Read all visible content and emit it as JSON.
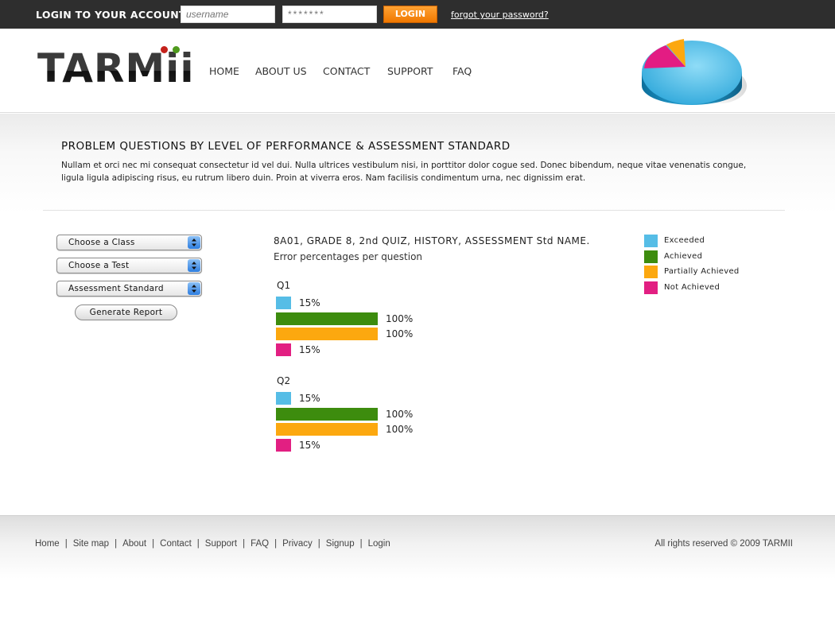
{
  "login": {
    "title": "LOGIN TO YOUR ACCOUNT",
    "username_placeholder": "username",
    "password_mask": "*******",
    "login_label": "LOGIN",
    "forgot_label": "forgot your password?"
  },
  "brand": {
    "logo_text": "TARMii"
  },
  "nav": {
    "items": [
      {
        "label": "HOME"
      },
      {
        "label": "ABOUT US"
      },
      {
        "label": "CONTACT"
      },
      {
        "label": "SUPPORT"
      },
      {
        "label": "FAQ"
      }
    ]
  },
  "intro": {
    "title": "PROBLEM QUESTIONS BY LEVEL OF PERFORMANCE & ASSESSMENT STANDARD",
    "text": "Nullam et orci nec mi consequat consectetur id vel dui. Nulla ultrices vestibulum nisi, in porttitor dolor cogue sed. Donec bibendum, neque vitae venenatis congue, ligula ligula adipiscing risus, eu rutrum libero duin. Proin at viverra eros. Nam facilisis condimentum urna, nec dignissim erat."
  },
  "controls": {
    "class_select": "Choose a Class",
    "test_select": "Choose a Test",
    "standard_select": "Assessment Standard",
    "generate_label": "Generate Report"
  },
  "report": {
    "title": "8A01, GRADE 8, 2nd QUIZ, HISTORY, ASSESSMENT Std NAME.",
    "subtitle": "Error percentages per question"
  },
  "legend": {
    "items": [
      {
        "label": "Exceeded",
        "color": "#56bde6"
      },
      {
        "label": "Achieved",
        "color": "#3d8c0e"
      },
      {
        "label": "Partially Achieved",
        "color": "#fca80f"
      },
      {
        "label": "Not Achieved",
        "color": "#e21f82"
      }
    ]
  },
  "chart_data": {
    "type": "bar",
    "orientation": "horizontal",
    "title": "Error percentages per question",
    "categories": [
      "Q1",
      "Q2"
    ],
    "value_suffix": "%",
    "series": [
      {
        "name": "Exceeded",
        "color": "#56bde6",
        "values": [
          15,
          15
        ]
      },
      {
        "name": "Achieved",
        "color": "#3d8c0e",
        "values": [
          100,
          100
        ]
      },
      {
        "name": "Partially Achieved",
        "color": "#fca80f",
        "values": [
          100,
          100
        ]
      },
      {
        "name": "Not Achieved",
        "color": "#e21f82",
        "values": [
          15,
          15
        ]
      }
    ],
    "xlim": [
      0,
      100
    ],
    "legend_placement": "right"
  },
  "footer": {
    "links": [
      {
        "label": "Home"
      },
      {
        "label": "Site map"
      },
      {
        "label": "About"
      },
      {
        "label": "Contact"
      },
      {
        "label": "Support"
      },
      {
        "label": "FAQ"
      },
      {
        "label": "Privacy"
      },
      {
        "label": "Signup"
      },
      {
        "label": "Login"
      }
    ],
    "copyright": "All rights reserved © 2009 TARMII"
  }
}
